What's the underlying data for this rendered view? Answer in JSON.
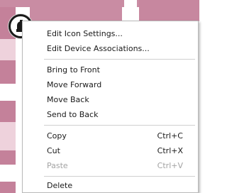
{
  "menu": {
    "items": [
      {
        "label": "Edit Icon Settings..."
      },
      {
        "label": "Edit Device Associations..."
      },
      {
        "label": "Bring to Front"
      },
      {
        "label": "Move Forward"
      },
      {
        "label": "Move Back"
      },
      {
        "label": "Send to Back"
      },
      {
        "label": "Copy",
        "shortcut": "Ctrl+C"
      },
      {
        "label": "Cut",
        "shortcut": "Ctrl+X"
      },
      {
        "label": "Paste",
        "shortcut": "Ctrl+V",
        "disabled": true
      },
      {
        "label": "Delete"
      }
    ]
  },
  "canvas": {
    "device_icon": "device-icon",
    "colors": {
      "canvas_pink": "#c4819a",
      "canvas_light": "#eed2dc",
      "canvas_white": "#ffffff"
    }
  }
}
